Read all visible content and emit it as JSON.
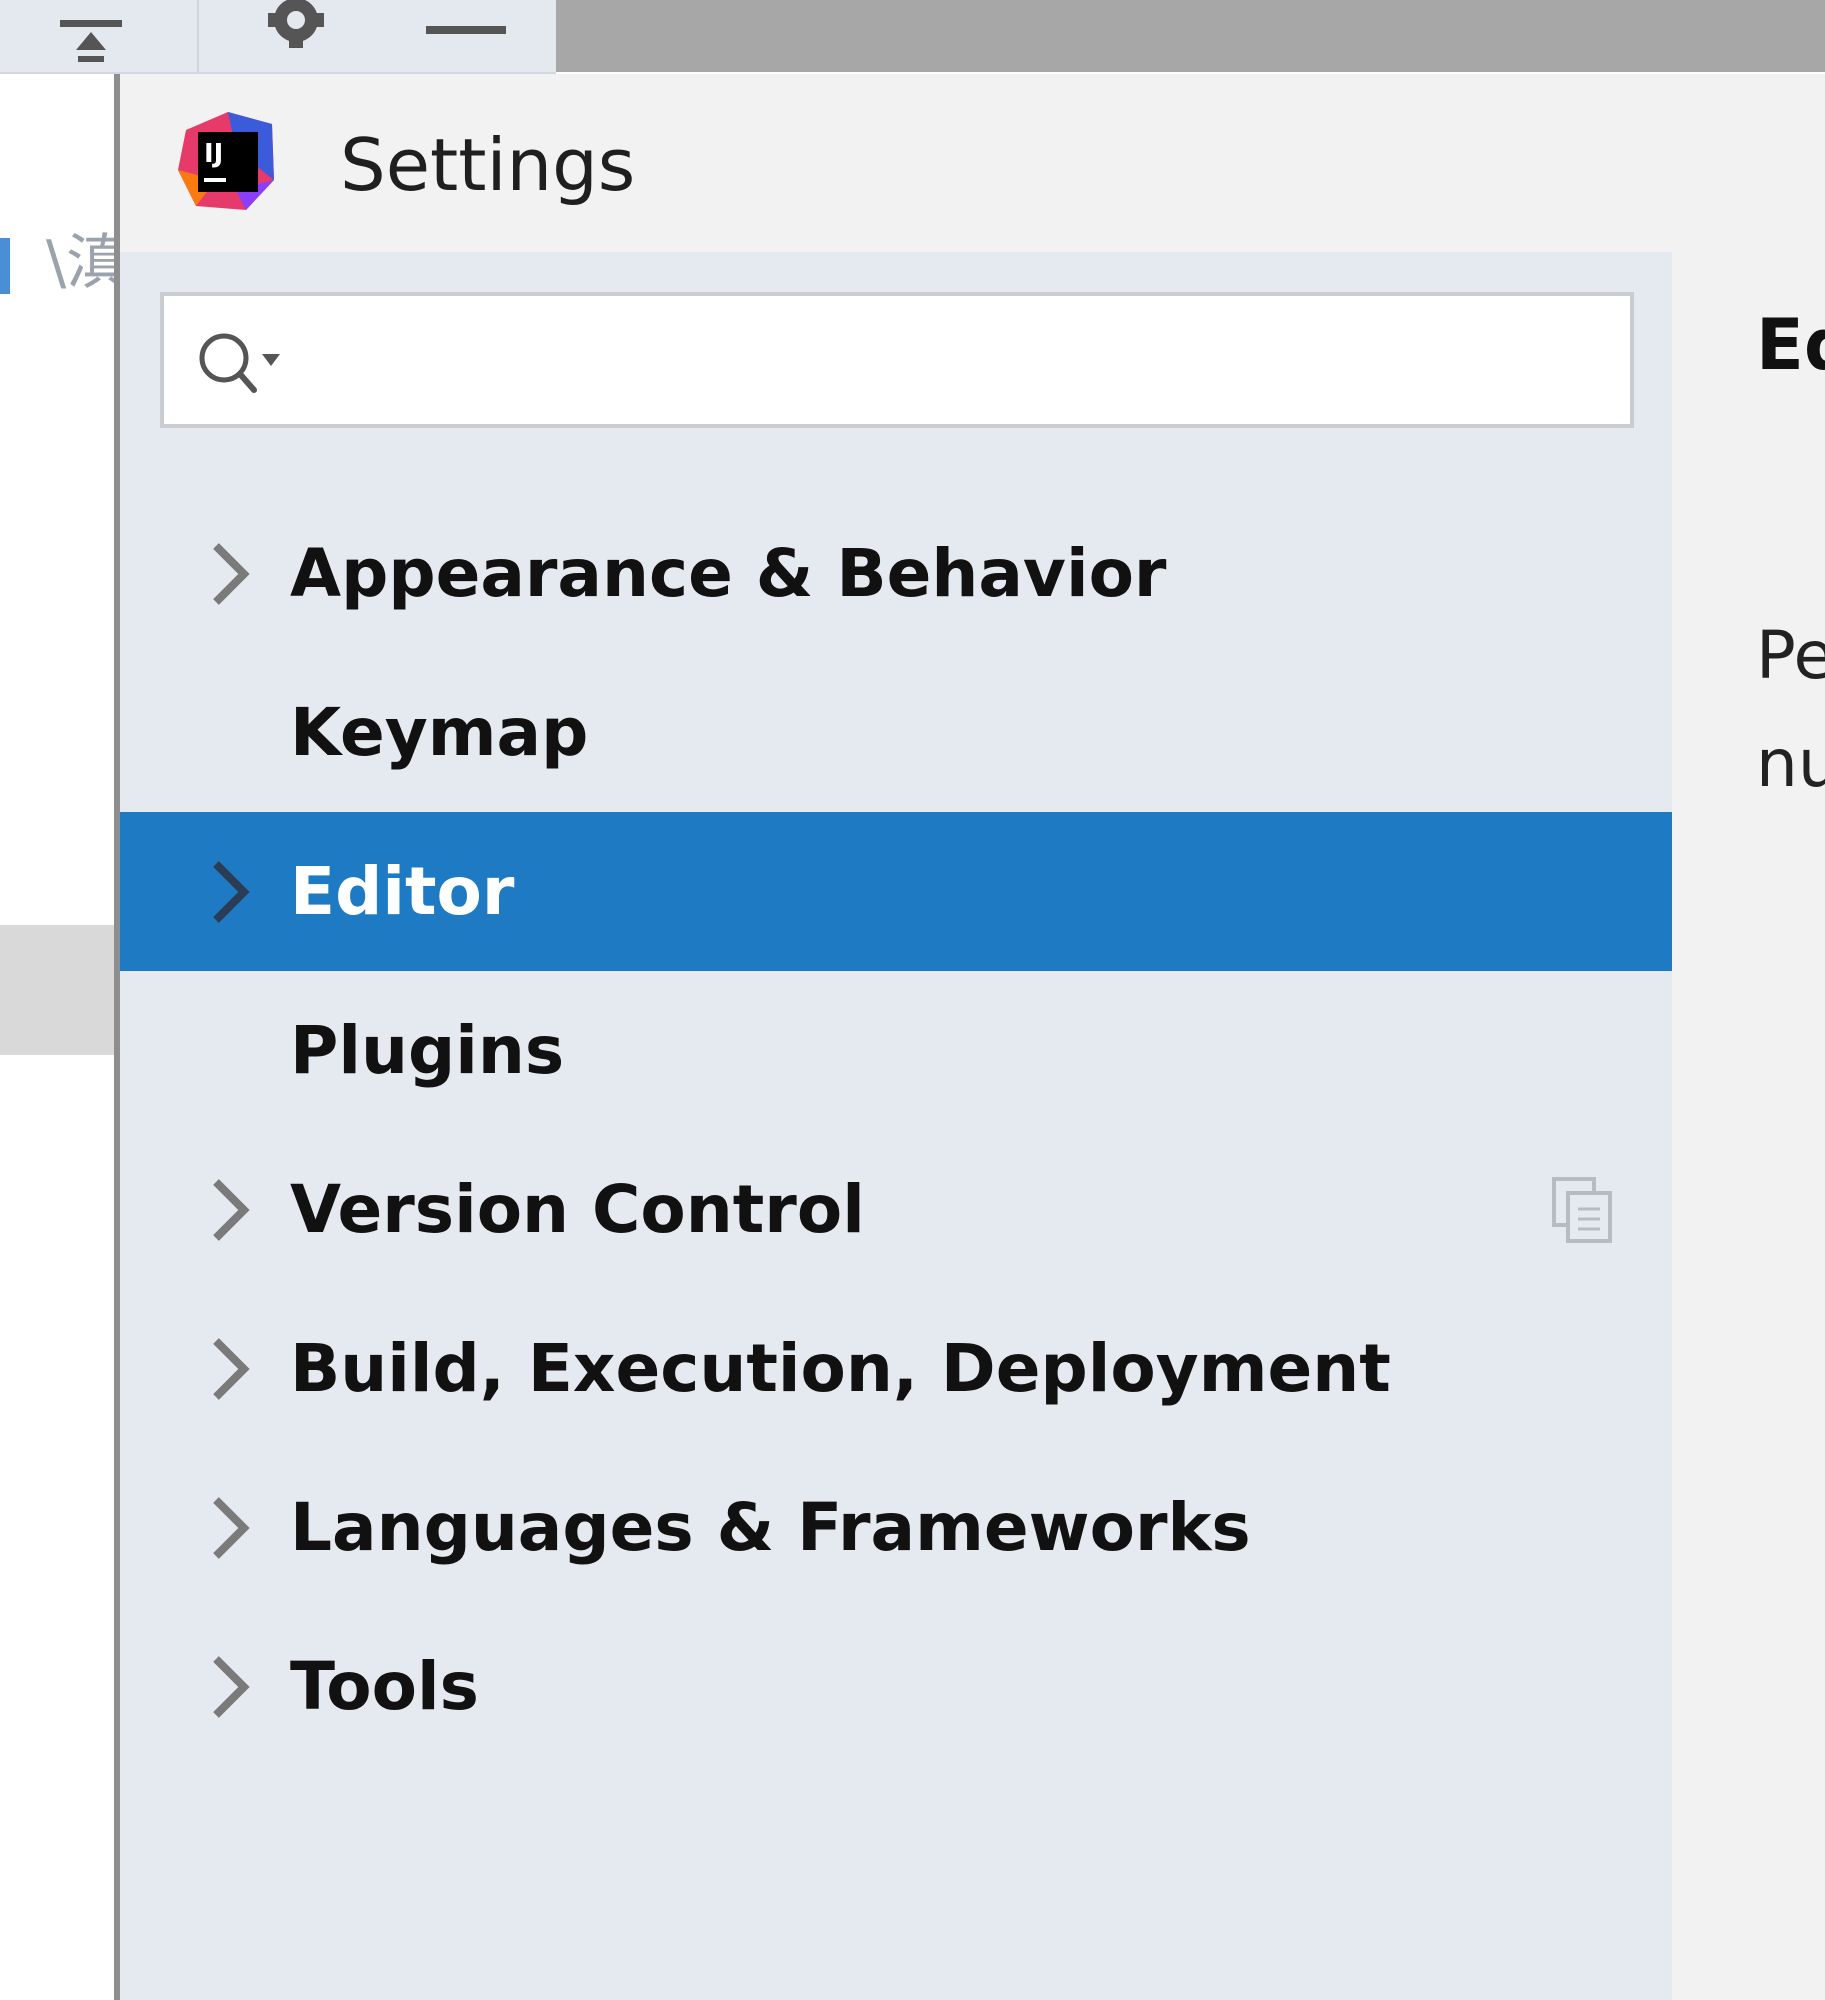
{
  "toolbar": {
    "icons": [
      "collapse-all-icon",
      "gear-icon",
      "minimize-icon"
    ]
  },
  "background_panel": {
    "partial_text": "\\滇"
  },
  "dialog": {
    "title": "Settings",
    "logo": "intellij-idea-logo"
  },
  "search": {
    "value": "",
    "placeholder": ""
  },
  "tree": {
    "items": [
      {
        "label": "Appearance & Behavior",
        "expandable": true,
        "selected": false
      },
      {
        "label": "Keymap",
        "expandable": false,
        "selected": false
      },
      {
        "label": "Editor",
        "expandable": true,
        "selected": true
      },
      {
        "label": "Plugins",
        "expandable": false,
        "selected": false
      },
      {
        "label": "Version Control",
        "expandable": true,
        "selected": false,
        "trailing_icon": "copy-project-settings-icon"
      },
      {
        "label": "Build, Execution, Deployment",
        "expandable": true,
        "selected": false
      },
      {
        "label": "Languages & Frameworks",
        "expandable": true,
        "selected": false
      },
      {
        "label": "Tools",
        "expandable": true,
        "selected": false
      }
    ]
  },
  "content": {
    "heading": "Ed",
    "description_line1": "Pe",
    "description_line2": "nu"
  },
  "colors": {
    "selection": "#1f7ac4",
    "sidebar_bg": "#e5eaf0",
    "dialog_bg": "#f2f2f2"
  }
}
